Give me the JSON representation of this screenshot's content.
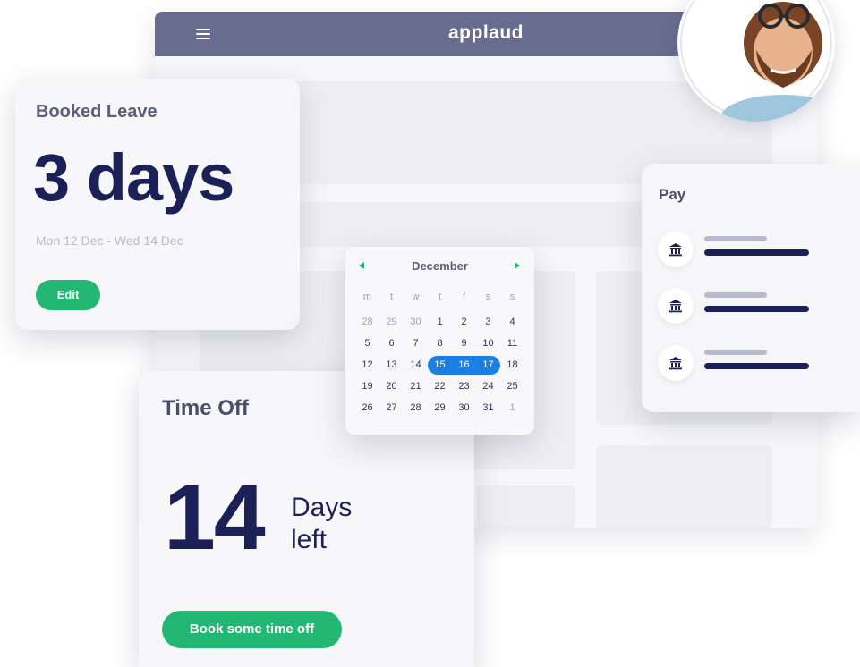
{
  "app": {
    "brand": "applaud",
    "menu_icon": "hamburger-icon"
  },
  "booked_leave": {
    "title": "Booked Leave",
    "value": "3 days",
    "range": "Mon 12 Dec - Wed 14 Dec",
    "edit_label": "Edit"
  },
  "time_off": {
    "title": "Time Off",
    "number": "14",
    "unit_line1": "Days",
    "unit_line2": "left",
    "book_label": "Book some time off"
  },
  "calendar": {
    "month": "December",
    "weekday_headers": [
      "m",
      "t",
      "w",
      "t",
      "f",
      "s",
      "s"
    ],
    "weeks": [
      [
        "28",
        "29",
        "30",
        "1",
        "2",
        "3",
        "4"
      ],
      [
        "5",
        "6",
        "7",
        "8",
        "9",
        "10",
        "11"
      ],
      [
        "12",
        "13",
        "14",
        "15",
        "16",
        "17",
        "18"
      ],
      [
        "19",
        "20",
        "21",
        "22",
        "23",
        "24",
        "25"
      ],
      [
        "26",
        "27",
        "28",
        "29",
        "30",
        "31",
        "1"
      ]
    ],
    "selected_days": [
      "15",
      "16",
      "17"
    ],
    "prev_icon": "triangle-left-icon",
    "next_icon": "triangle-right-icon"
  },
  "pay": {
    "title": "Pay",
    "row_icon": "bank-icon"
  },
  "colors": {
    "header": "#686c8e",
    "accent_green": "#22b873",
    "selection_blue": "#1c7fe4",
    "navy": "#1b2157"
  }
}
